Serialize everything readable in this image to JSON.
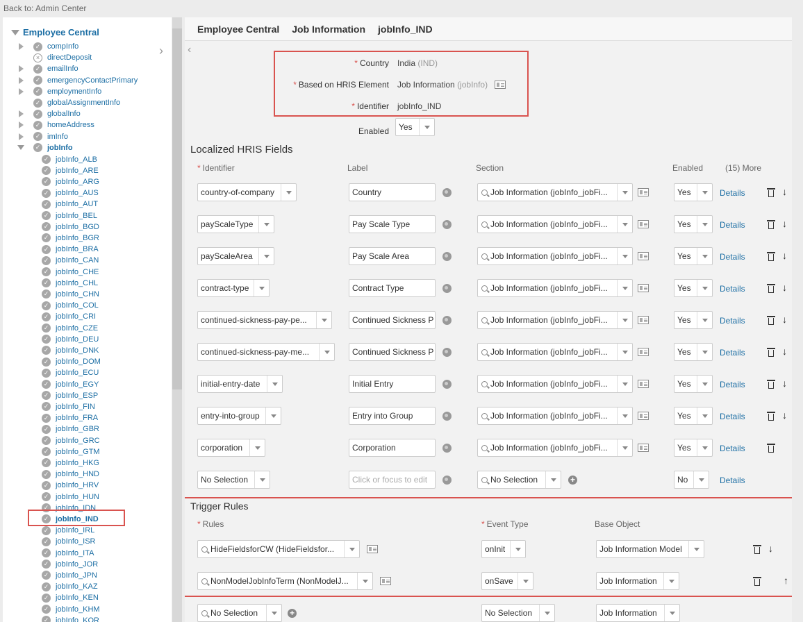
{
  "back_link": "Back to: Admin Center",
  "sidebar": {
    "root": "Employee Central",
    "items": [
      {
        "label": "compInfo",
        "expandable": true,
        "icon": "check"
      },
      {
        "label": "directDeposit",
        "expandable": false,
        "icon": "x"
      },
      {
        "label": "emailInfo",
        "expandable": true,
        "icon": "check"
      },
      {
        "label": "emergencyContactPrimary",
        "expandable": true,
        "icon": "check"
      },
      {
        "label": "employmentInfo",
        "expandable": true,
        "icon": "check"
      },
      {
        "label": "globalAssignmentInfo",
        "expandable": false,
        "icon": "check"
      },
      {
        "label": "globalInfo",
        "expandable": true,
        "icon": "check"
      },
      {
        "label": "homeAddress",
        "expandable": true,
        "icon": "check"
      },
      {
        "label": "imInfo",
        "expandable": true,
        "icon": "check"
      },
      {
        "label": "jobInfo",
        "expandable": true,
        "expanded": true,
        "icon": "check"
      }
    ],
    "children": [
      "jobInfo_ALB",
      "jobInfo_ARE",
      "jobInfo_ARG",
      "jobInfo_AUS",
      "jobInfo_AUT",
      "jobInfo_BEL",
      "jobInfo_BGD",
      "jobInfo_BGR",
      "jobInfo_BRA",
      "jobInfo_CAN",
      "jobInfo_CHE",
      "jobInfo_CHL",
      "jobInfo_CHN",
      "jobInfo_COL",
      "jobInfo_CRI",
      "jobInfo_CZE",
      "jobInfo_DEU",
      "jobInfo_DNK",
      "jobInfo_DOM",
      "jobInfo_ECU",
      "jobInfo_EGY",
      "jobInfo_ESP",
      "jobInfo_FIN",
      "jobInfo_FRA",
      "jobInfo_GBR",
      "jobInfo_GRC",
      "jobInfo_GTM",
      "jobInfo_HKG",
      "jobInfo_HND",
      "jobInfo_HRV",
      "jobInfo_HUN",
      "jobInfo_IDN",
      "jobInfo_IND",
      "jobInfo_IRL",
      "jobInfo_ISR",
      "jobInfo_ITA",
      "jobInfo_JOR",
      "jobInfo_JPN",
      "jobInfo_KAZ",
      "jobInfo_KEN",
      "jobInfo_KHM",
      "jobInfo_KOR"
    ],
    "selected": "jobInfo_IND"
  },
  "breadcrumb": [
    "Employee Central",
    "Job Information",
    "jobInfo_IND"
  ],
  "header_fields": {
    "country_label": "Country",
    "country_value": "India",
    "country_code": "(IND)",
    "hris_label": "Based on HRIS Element",
    "hris_value": "Job Information",
    "hris_code": "(jobInfo)",
    "identifier_label": "Identifier",
    "identifier_value": "jobInfo_IND",
    "enabled_label": "Enabled",
    "enabled_value": "Yes"
  },
  "localized": {
    "title": "Localized HRIS Fields",
    "columns": {
      "identifier": "Identifier",
      "label": "Label",
      "section": "Section",
      "enabled": "Enabled",
      "more": "(15) More"
    },
    "rows": [
      {
        "identifier": "country-of-company",
        "label": "Country",
        "section": "Job Information (jobInfo_jobFi...",
        "enabled": "Yes",
        "details": "Details",
        "down": true
      },
      {
        "identifier": "payScaleType",
        "label": "Pay Scale Type",
        "section": "Job Information (jobInfo_jobFi...",
        "enabled": "Yes",
        "details": "Details",
        "down": true
      },
      {
        "identifier": "payScaleArea",
        "label": "Pay Scale Area",
        "section": "Job Information (jobInfo_jobFi...",
        "enabled": "Yes",
        "details": "Details",
        "down": true
      },
      {
        "identifier": "contract-type",
        "label": "Contract Type",
        "section": "Job Information (jobInfo_jobFi...",
        "enabled": "Yes",
        "details": "Details",
        "down": true
      },
      {
        "identifier": "continued-sickness-pay-pe...",
        "label": "Continued Sickness P",
        "section": "Job Information (jobInfo_jobFi...",
        "enabled": "Yes",
        "details": "Details",
        "down": true
      },
      {
        "identifier": "continued-sickness-pay-me...",
        "label": "Continued Sickness P",
        "section": "Job Information (jobInfo_jobFi...",
        "enabled": "Yes",
        "details": "Details",
        "down": true
      },
      {
        "identifier": "initial-entry-date",
        "label": "Initial Entry",
        "section": "Job Information (jobInfo_jobFi...",
        "enabled": "Yes",
        "details": "Details",
        "down": true
      },
      {
        "identifier": "entry-into-group",
        "label": "Entry into Group",
        "section": "Job Information (jobInfo_jobFi...",
        "enabled": "Yes",
        "details": "Details",
        "down": true
      },
      {
        "identifier": "corporation",
        "label": "Corporation",
        "section": "Job Information (jobInfo_jobFi...",
        "enabled": "Yes",
        "details": "Details",
        "down": false
      }
    ],
    "new_row": {
      "identifier": "No Selection",
      "label_placeholder": "Click or focus to edit",
      "section": "No Selection",
      "enabled": "No",
      "details": "Details"
    }
  },
  "trigger": {
    "title": "Trigger Rules",
    "columns": {
      "rules": "Rules",
      "event": "Event Type",
      "base": "Base Object"
    },
    "rows": [
      {
        "rule": "HideFieldsforCW (HideFieldsfor...",
        "event": "onInit",
        "base": "Job Information Model",
        "arrow": "↓"
      },
      {
        "rule": "NonModelJobInfoTerm (NonModelJ...",
        "event": "onSave",
        "base": "Job Information",
        "arrow": "↑"
      }
    ],
    "new_row": {
      "rule": "No Selection",
      "event": "No Selection",
      "base": "Job Information"
    }
  }
}
